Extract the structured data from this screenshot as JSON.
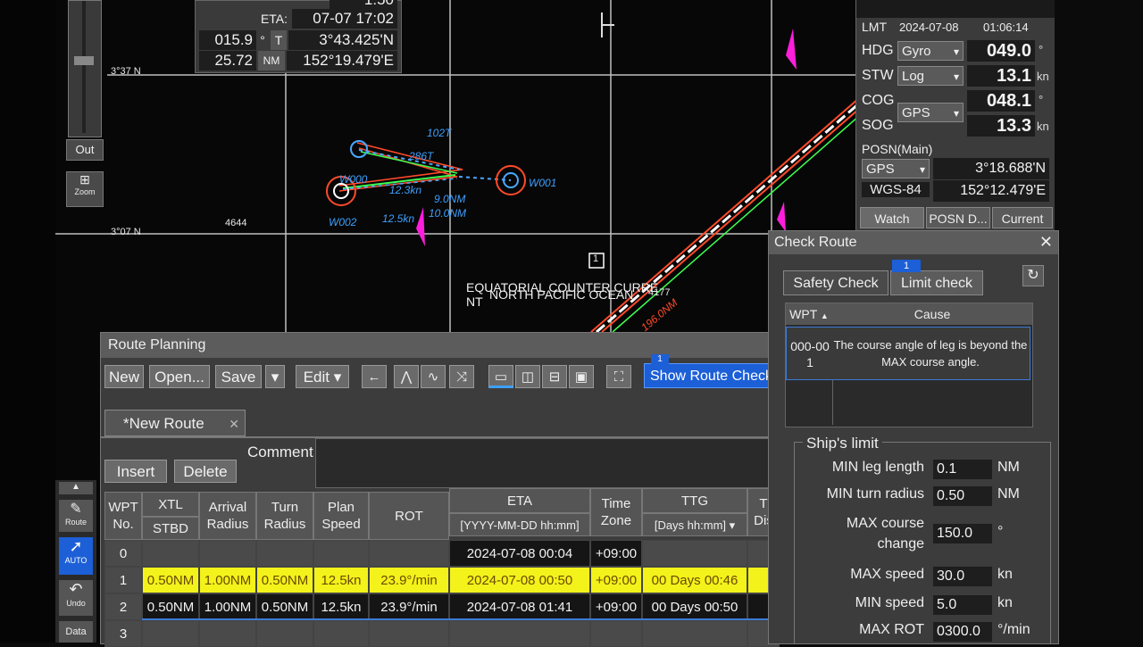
{
  "chart": {
    "lat_top": "3°37 N",
    "lat_mid": "3°07 N",
    "depth": "4644",
    "region_a": "EQUATORIAL COUNTER CURRE",
    "region_b": "NT",
    "region_c": "NORTH PACIFIC OCEAN",
    "region_num": "4177",
    "wp_w000": "W000",
    "wp_w001": "W001",
    "wp_w002": "W002",
    "lbl_102t": "102T",
    "lbl_286t": "286T",
    "lbl_speed1": "12.3kn",
    "lbl_dist1": "9.0NM",
    "lbl_speed2": "12.5kn",
    "lbl_dist2": "10.0NM",
    "lbl_196nm": "196.0NM",
    "lbl_ref": "1"
  },
  "left_toolbar": {
    "out": "Out",
    "zoom": "Zoom",
    "route": "Route",
    "auto": "AUTO",
    "undo": "Undo",
    "data": "Data"
  },
  "info_panel": {
    "top_value": "1:50",
    "eta_label": "ETA:",
    "eta_value": "07-07 17:02",
    "bearing": "015.9",
    "bearing_unit": "°",
    "bearing_ref": "T",
    "lat": "3°43.425'N",
    "distance": "25.72",
    "distance_unit": "NM",
    "lon": "152°19.479'E"
  },
  "sensor": {
    "lmt_label": "LMT",
    "date": "2024-07-08",
    "time": "01:06:14",
    "hdg_label": "HDG",
    "hdg_source": "Gyro",
    "hdg_value": "049.0",
    "hdg_unit": "°",
    "stw_label": "STW",
    "stw_source": "Log",
    "stw_value": "13.1",
    "stw_unit": "kn",
    "cog_label": "COG",
    "cog_value": "048.1",
    "cog_unit": "°",
    "sog_label": "SOG",
    "sog_source": "GPS",
    "sog_value": "13.3",
    "sog_unit": "kn",
    "posn_label": "POSN(Main)",
    "posn_source": "GPS",
    "posn_lat": "3°18.688'N",
    "datum": "WGS-84",
    "posn_lon": "152°12.479'E",
    "tabs": [
      "Watch",
      "POSN D...",
      "Current"
    ]
  },
  "route_planning": {
    "title": "Route Planning",
    "toolbar": {
      "new": "New",
      "open": "Open...",
      "save": "Save",
      "edit": "Edit",
      "show_check": "Show Route Check",
      "check_badge": "1"
    },
    "tab": "*New Route",
    "insert": "Insert",
    "delete": "Delete",
    "comment": "Comment",
    "headers": {
      "wpt_no": "WPT No.",
      "xtl": "XTL",
      "stbd": "STBD",
      "arrival_radius": "Arrival Radius",
      "turn_radius": "Turn Radius",
      "plan_speed": "Plan Speed",
      "rot": "ROT",
      "eta": "ETA",
      "eta_format": "[YYYY-MM-DD hh:mm]",
      "time_zone": "Time Zone",
      "ttg": "TTG",
      "ttg_format": "[Days hh:mm]",
      "dist": "T Dis"
    },
    "rows": [
      {
        "wpt": "0",
        "xtl": "",
        "arrival": "",
        "turn": "",
        "speed": "",
        "rot": "",
        "eta": "2024-07-08 00:04",
        "tz": "+09:00",
        "ttg": ""
      },
      {
        "wpt": "1",
        "xtl": "0.50NM",
        "arrival": "1.00NM",
        "turn": "0.50NM",
        "speed": "12.5kn",
        "rot": "23.9°/min",
        "eta": "2024-07-08 00:50",
        "tz": "+09:00",
        "ttg": "00 Days 00:46"
      },
      {
        "wpt": "2",
        "xtl": "0.50NM",
        "arrival": "1.00NM",
        "turn": "0.50NM",
        "speed": "12.5kn",
        "rot": "23.9°/min",
        "eta": "2024-07-08 01:41",
        "tz": "+09:00",
        "ttg": "00 Days 00:50"
      },
      {
        "wpt": "3",
        "xtl": "",
        "arrival": "",
        "turn": "",
        "speed": "",
        "rot": "",
        "eta": "",
        "tz": "",
        "ttg": ""
      }
    ]
  },
  "check_route": {
    "title": "Check Route",
    "tab_safety": "Safety Check",
    "tab_limit": "Limit check",
    "limit_badge": "1",
    "col_wpt": "WPT",
    "col_cause": "Cause",
    "result_wpt": "000-001",
    "result_cause": "The course angle of leg is beyond the MAX course angle.",
    "ships_limit": "Ship's limit",
    "limits": [
      {
        "label": "MIN leg length",
        "value": "0.1",
        "unit": "NM"
      },
      {
        "label": "MIN turn radius",
        "value": "0.50",
        "unit": "NM"
      },
      {
        "label": "MAX course change",
        "value": "150.0",
        "unit": "°"
      },
      {
        "label": "MAX speed",
        "value": "30.0",
        "unit": "kn"
      },
      {
        "label": "MIN speed",
        "value": "5.0",
        "unit": "kn"
      },
      {
        "label": "MAX ROT",
        "value": "0300.0",
        "unit": "°/min"
      }
    ]
  },
  "colors": {
    "route_red": "#ff4a2a",
    "route_green": "#3cff50",
    "wp_blue": "#3da0ff",
    "highlight_yellow": "#f3f21a",
    "accent_blue": "#1c5fd6",
    "marker_magenta": "#ff1edc"
  }
}
